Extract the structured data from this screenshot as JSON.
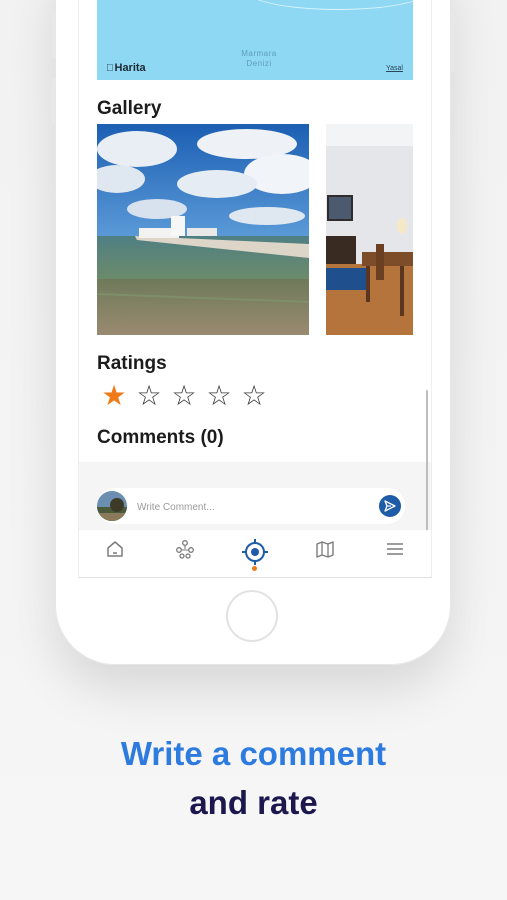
{
  "map": {
    "logo": "Harita",
    "sea_label_line1": "Marmara",
    "sea_label_line2": "Denizi",
    "legal": "Yasal"
  },
  "gallery": {
    "title": "Gallery",
    "photos": [
      {
        "name": "pier-on-beach-photo"
      },
      {
        "name": "interior-room-photo"
      }
    ]
  },
  "ratings": {
    "title": "Ratings",
    "value": 1,
    "max": 5,
    "filled_color": "#f07a18"
  },
  "comments": {
    "title": "Comments (0)",
    "placeholder": "Write Comment..."
  },
  "tabbar": {
    "items": [
      {
        "icon": "home-icon"
      },
      {
        "icon": "people-network-icon"
      },
      {
        "icon": "location-target-icon",
        "active": true
      },
      {
        "icon": "map-icon"
      },
      {
        "icon": "menu-icon"
      }
    ],
    "active_color": "#1f5ca8",
    "indicator_color": "#f07a18"
  },
  "headline": {
    "line1": "Write a comment",
    "line2": "and rate",
    "line1_color": "#2e7be0",
    "line2_color": "#1c174d"
  }
}
